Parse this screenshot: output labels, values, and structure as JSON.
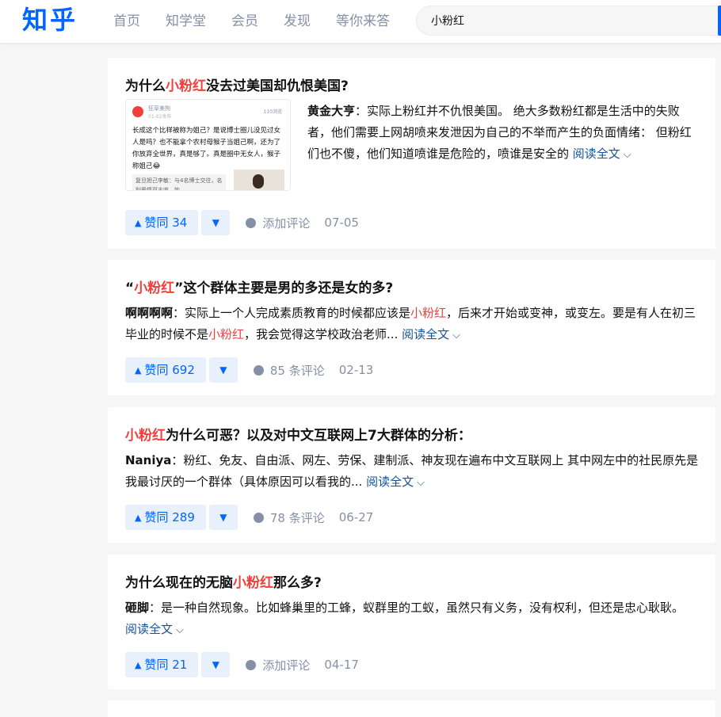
{
  "header": {
    "logo": "知乎",
    "nav": [
      "首页",
      "知学堂",
      "会员",
      "发现",
      "等你来答"
    ],
    "search_value": "小粉红",
    "accent_color": "#0066ff"
  },
  "results": [
    {
      "title_pre": "为什么",
      "title_hl": "小粉红",
      "title_post": "没去过美国却仇恨美国?",
      "has_thumb": true,
      "thumb": {
        "account": "狂草美狗",
        "date": "01-02发布",
        "count": "110浏览",
        "text": "长成这个比样被称为姐己？是说博士圈儿没见过女人是吗？也不能拿个农村母猴子当姐己啊，还为了你放弃全世界，真是够了。真是圈中无女人，猴子称姐己😂",
        "quote": "复旦妲己李敏：与4名博士交往，名利爱情双丰收，妙…"
      },
      "author": "黄金大亨",
      "excerpt": "：实际上粉红并不仇恨美国。 绝大多数粉红都是生活中的失败者，他们需要上网胡喷来发泄因为自己的不举而产生的负面情绪： 但粉红们也不傻，他们知道喷谁是危险的，喷谁是安全的",
      "read_more": "阅读全文",
      "votes": "赞同 34",
      "comments": "添加评论",
      "date": "07-05"
    },
    {
      "title_pre": "“",
      "title_hl": "小粉红",
      "title_post": "”这个群体主要是男的多还是女的多?",
      "author": "啊啊啊啊",
      "excerpt_a": "：实际上一个人完成素质教育的时候都应该是",
      "excerpt_hl1": "小粉红",
      "excerpt_b": "，后来才开始或变神，或变左。要是有人在初三毕业的时候不是",
      "excerpt_hl2": "小粉红",
      "excerpt_c": "，我会觉得这学校政治老师...",
      "read_more": "阅读全文",
      "votes": "赞同 692",
      "comments": "85 条评论",
      "date": "02-13"
    },
    {
      "title_pre": "",
      "title_hl": "小粉红",
      "title_post": "为什么可恶？以及对中文互联网上7大群体的分析：",
      "author": "Naniya",
      "excerpt": "：粉红、免友、自由派、网左、劳保、建制派、神友现在遍布中文互联网上 其中网左中的社民原先是我最讨厌的一个群体（具体原因可以看我的...",
      "read_more": "阅读全文",
      "votes": "赞同 289",
      "comments": "78 条评论",
      "date": "06-27"
    },
    {
      "title_pre": "为什么现在的无脑",
      "title_hl": "小粉红",
      "title_post": "那么多?",
      "author": "砸脚",
      "excerpt": "：是一种自然现象。比如蜂巢里的工蜂，蚁群里的工蚁，虽然只有义务，没有权利，但还是忠心耿耿。",
      "read_more": "阅读全文",
      "votes": "赞同 21",
      "comments": "添加评论",
      "date": "04-17"
    }
  ]
}
